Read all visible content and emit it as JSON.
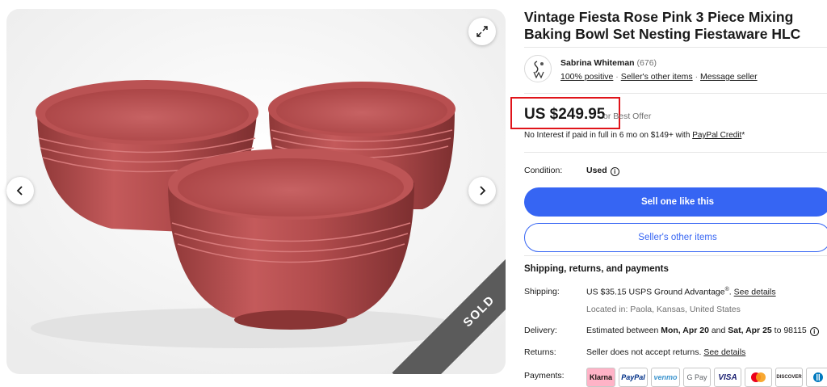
{
  "gallery": {
    "sold_label": "SOLD"
  },
  "listing": {
    "title": "Vintage Fiesta Rose Pink 3 Piece Mixing Baking Bowl Set Nesting Fiestaware HLC"
  },
  "seller": {
    "name": "Sabrina Whiteman",
    "feedback_count": "(676)",
    "positive": "100% positive",
    "sep1": " · ",
    "other_items": "Seller's other items",
    "sep2": " · ",
    "message": "Message seller"
  },
  "price": {
    "amount": "US $249.95",
    "offer": "or Best Offer",
    "financing_prefix": "No Interest if paid in full in 6 mo on $149+ with ",
    "financing_link": "PayPal Credit",
    "financing_suffix": "*"
  },
  "condition": {
    "label": "Condition:",
    "value": "Used"
  },
  "buttons": {
    "sell_one": "Sell one like this",
    "sellers_other_items": "Seller's other items"
  },
  "shipping": {
    "heading": "Shipping, returns, and payments",
    "shipping_label": "Shipping:",
    "shipping_value": "US $35.15 USPS Ground Advantage",
    "shipping_reg": "®",
    "shipping_link": "See details",
    "location": "Located in: Paola, Kansas, United States",
    "delivery_label": "Delivery:",
    "delivery_prefix": "Estimated between ",
    "delivery_start": "Mon, Apr 20",
    "delivery_and": " and ",
    "delivery_end": "Sat, Apr 25",
    "delivery_suffix": " to 98115",
    "returns_label": "Returns:",
    "returns_value": "Seller does not accept returns. ",
    "returns_link": "See details",
    "payments_label": "Payments:"
  },
  "payment_methods": [
    "Klarna",
    "PayPal",
    "venmo",
    "G Pay",
    "VISA",
    "Mastercard",
    "DISCOVER",
    "Diners Club"
  ],
  "colors": {
    "accent": "#3665f3",
    "highlight_box": "#e0141a",
    "bowl": "#b54e4f",
    "sold_ribbon": "#5b5b5b"
  }
}
